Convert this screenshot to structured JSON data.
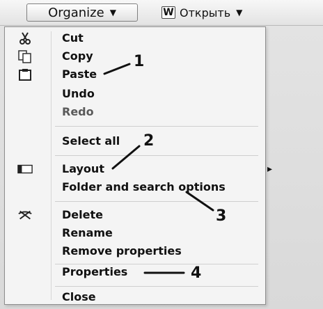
{
  "toolbar": {
    "organize_label": "Organize",
    "open_label": "Открыть",
    "word_icon": "W",
    "dropdown_icon": "chevron-down-icon"
  },
  "menu": {
    "items": [
      {
        "label": "Cut",
        "icon": "scissors-icon"
      },
      {
        "label": "Copy",
        "icon": "copy-icon"
      },
      {
        "label": "Paste",
        "icon": "paste-icon"
      },
      {
        "label": "Undo",
        "icon": ""
      },
      {
        "label": "Redo",
        "icon": ""
      },
      {
        "label": "Select all",
        "icon": ""
      },
      {
        "label": "Layout",
        "icon": "layout-icon"
      },
      {
        "label": "Folder and search options",
        "icon": ""
      },
      {
        "label": "Delete",
        "icon": "delete-icon"
      },
      {
        "label": "Rename",
        "icon": ""
      },
      {
        "label": "Remove properties",
        "icon": ""
      },
      {
        "label": "Properties",
        "icon": ""
      },
      {
        "label": "Close",
        "icon": ""
      }
    ],
    "layout_submenu_icon": "chevron-right-icon"
  },
  "annotations": {
    "n1": "1",
    "n2": "2",
    "n3": "3",
    "n4": "4"
  }
}
